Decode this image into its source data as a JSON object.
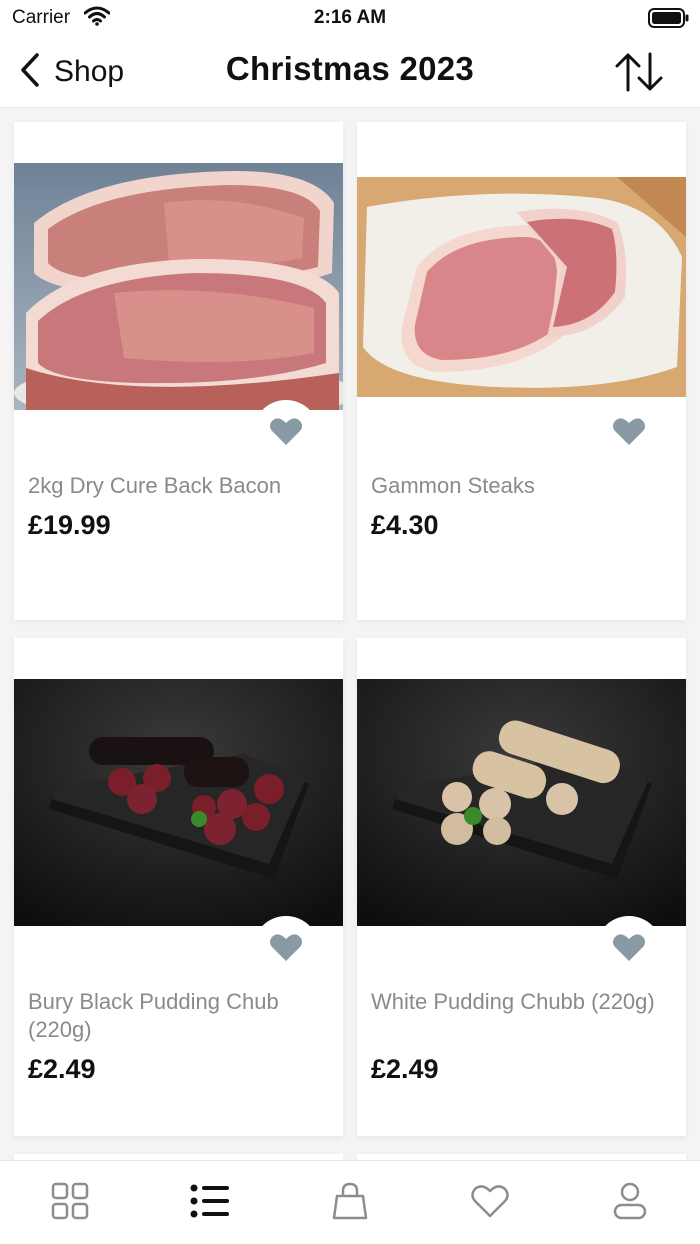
{
  "status_bar": {
    "carrier": "Carrier",
    "time": "2:16 AM"
  },
  "nav": {
    "back_label": "Shop",
    "title": "Christmas 2023"
  },
  "products": [
    {
      "name": "2kg Dry Cure Back Bacon",
      "price": "£19.99",
      "image": "bacon-photo"
    },
    {
      "name": "Gammon Steaks",
      "price": "£4.30",
      "image": "gammon-photo"
    },
    {
      "name": "Bury Black Pudding Chub (220g)",
      "price": "£2.49",
      "image": "black-pudding-photo"
    },
    {
      "name": "White Pudding Chubb (220g)",
      "price": "£2.49",
      "image": "white-pudding-photo"
    }
  ],
  "tabs": [
    {
      "icon": "grid-icon",
      "active": false
    },
    {
      "icon": "list-icon",
      "active": true
    },
    {
      "icon": "bag-icon",
      "active": false
    },
    {
      "icon": "heart-icon",
      "active": false
    },
    {
      "icon": "profile-icon",
      "active": false
    }
  ],
  "colors": {
    "heart": "#8a9aa5",
    "tab_icon": "#8d8d8d",
    "tab_icon_active": "#111111",
    "product_name": "#8a8a8a"
  }
}
